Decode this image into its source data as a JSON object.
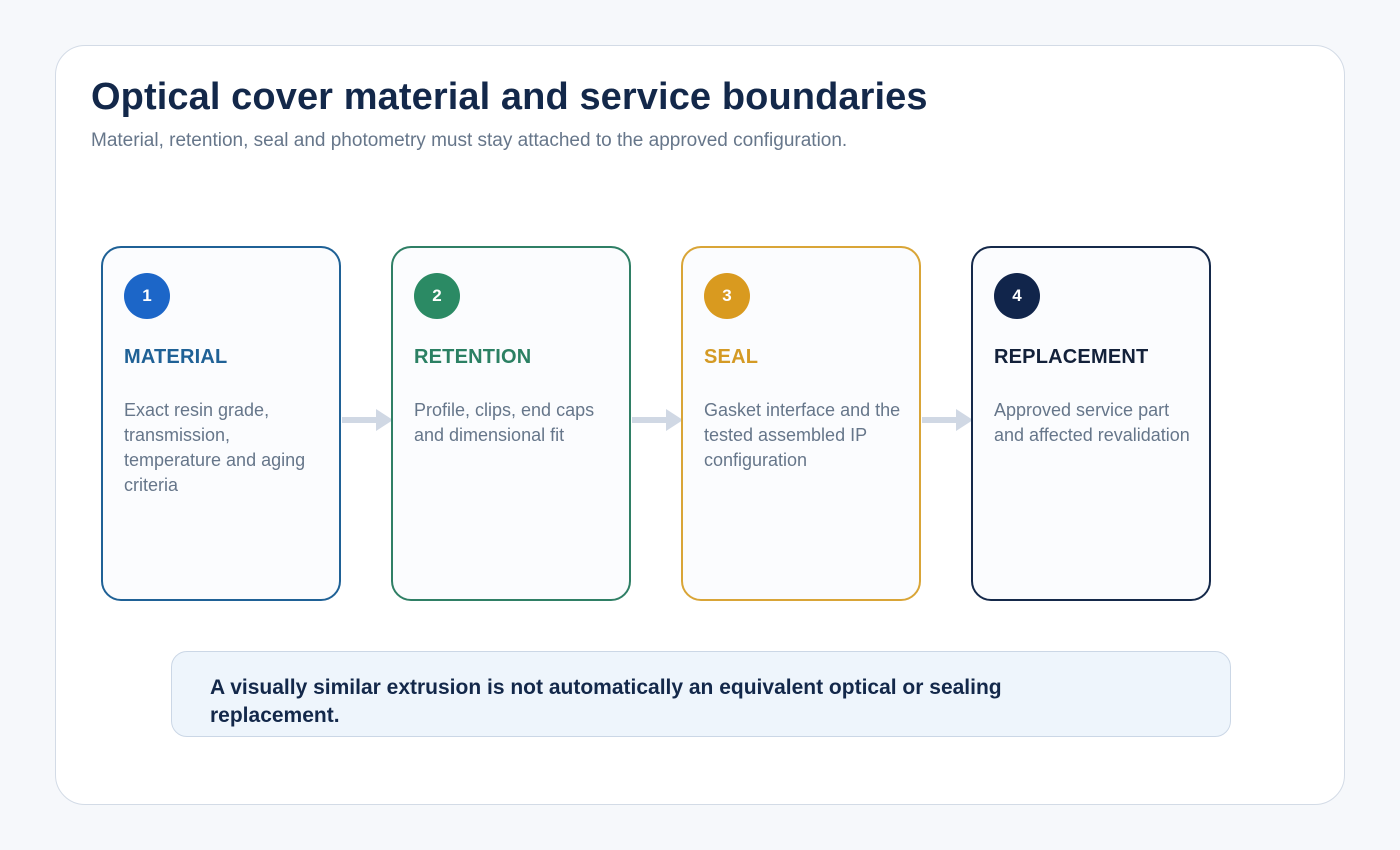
{
  "header": {
    "title": "Optical cover material and service boundaries",
    "subtitle": "Material, retention, seal and photometry must stay attached to the approved configuration."
  },
  "steps": [
    {
      "number": "1",
      "label": "MATERIAL",
      "description": "Exact resin grade, transmission, temperature and aging criteria",
      "color": "#1f6196"
    },
    {
      "number": "2",
      "label": "RETENTION",
      "description": "Profile, clips, end caps and dimensional fit",
      "color": "#2b8063"
    },
    {
      "number": "3",
      "label": "SEAL",
      "description": "Gasket interface and the tested assembled IP configuration",
      "color": "#d49a25"
    },
    {
      "number": "4",
      "label": "REPLACEMENT",
      "description": "Approved service part and affected revalidation",
      "color": "#13213a"
    }
  ],
  "note": {
    "text": "A visually similar extrusion is not automatically an equivalent optical or sealing replacement."
  },
  "colors": {
    "arrow": "#d0d8e4",
    "title": "#13284a",
    "muted_text": "#66768a"
  }
}
